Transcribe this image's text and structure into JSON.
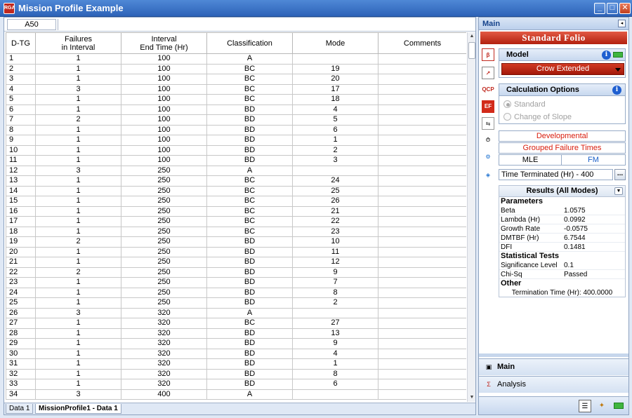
{
  "window": {
    "title": "Mission Profile Example",
    "icon_text": "RGA",
    "controls": [
      "minimize-icon",
      "maximize-icon",
      "close-icon"
    ]
  },
  "sheet": {
    "cell_ref": "A50",
    "columns": [
      {
        "line1": "D-TG",
        "line2": ""
      },
      {
        "line1": "Failures",
        "line2": "in Interval"
      },
      {
        "line1": "Interval",
        "line2": "End Time (Hr)"
      },
      {
        "line1": "Classification",
        "line2": ""
      },
      {
        "line1": "Mode",
        "line2": ""
      },
      {
        "line1": "Comments",
        "line2": ""
      }
    ],
    "rows": [
      [
        "1",
        "1",
        "100",
        "A",
        "",
        ""
      ],
      [
        "2",
        "1",
        "100",
        "BC",
        "19",
        ""
      ],
      [
        "3",
        "1",
        "100",
        "BC",
        "20",
        ""
      ],
      [
        "4",
        "3",
        "100",
        "BC",
        "17",
        ""
      ],
      [
        "5",
        "1",
        "100",
        "BC",
        "18",
        ""
      ],
      [
        "6",
        "1",
        "100",
        "BD",
        "4",
        ""
      ],
      [
        "7",
        "2",
        "100",
        "BD",
        "5",
        ""
      ],
      [
        "8",
        "1",
        "100",
        "BD",
        "6",
        ""
      ],
      [
        "9",
        "1",
        "100",
        "BD",
        "1",
        ""
      ],
      [
        "10",
        "1",
        "100",
        "BD",
        "2",
        ""
      ],
      [
        "11",
        "1",
        "100",
        "BD",
        "3",
        ""
      ],
      [
        "12",
        "3",
        "250",
        "A",
        "",
        ""
      ],
      [
        "13",
        "1",
        "250",
        "BC",
        "24",
        ""
      ],
      [
        "14",
        "1",
        "250",
        "BC",
        "25",
        ""
      ],
      [
        "15",
        "1",
        "250",
        "BC",
        "26",
        ""
      ],
      [
        "16",
        "1",
        "250",
        "BC",
        "21",
        ""
      ],
      [
        "17",
        "1",
        "250",
        "BC",
        "22",
        ""
      ],
      [
        "18",
        "1",
        "250",
        "BC",
        "23",
        ""
      ],
      [
        "19",
        "2",
        "250",
        "BD",
        "10",
        ""
      ],
      [
        "20",
        "1",
        "250",
        "BD",
        "11",
        ""
      ],
      [
        "21",
        "1",
        "250",
        "BD",
        "12",
        ""
      ],
      [
        "22",
        "2",
        "250",
        "BD",
        "9",
        ""
      ],
      [
        "23",
        "1",
        "250",
        "BD",
        "7",
        ""
      ],
      [
        "24",
        "1",
        "250",
        "BD",
        "8",
        ""
      ],
      [
        "25",
        "1",
        "250",
        "BD",
        "2",
        ""
      ],
      [
        "26",
        "3",
        "320",
        "A",
        "",
        ""
      ],
      [
        "27",
        "1",
        "320",
        "BC",
        "27",
        ""
      ],
      [
        "28",
        "1",
        "320",
        "BD",
        "13",
        ""
      ],
      [
        "29",
        "1",
        "320",
        "BD",
        "9",
        ""
      ],
      [
        "30",
        "1",
        "320",
        "BD",
        "4",
        ""
      ],
      [
        "31",
        "1",
        "320",
        "BD",
        "1",
        ""
      ],
      [
        "32",
        "1",
        "320",
        "BD",
        "8",
        ""
      ],
      [
        "33",
        "1",
        "320",
        "BD",
        "6",
        ""
      ],
      [
        "34",
        "3",
        "400",
        "A",
        "",
        ""
      ]
    ],
    "tabs": [
      "Data 1",
      "MissionProfile1 - Data 1"
    ]
  },
  "panel": {
    "header": "Main",
    "folio_title": "Standard Folio",
    "model": {
      "title": "Model",
      "selected": "Crow Extended"
    },
    "calc_options": {
      "title": "Calculation Options",
      "options": [
        "Standard",
        "Change of Slope"
      ]
    },
    "developmental": "Developmental",
    "grouped": "Grouped Failure Times",
    "mle": "MLE",
    "fm": "FM",
    "time_terminated": "Time Terminated (Hr) - 400",
    "dots": "...",
    "results": {
      "title": "Results (All Modes)",
      "parameters_label": "Parameters",
      "parameters": [
        {
          "k": "Beta",
          "v": "1.0575"
        },
        {
          "k": "Lambda (Hr)",
          "v": "0.0992"
        },
        {
          "k": "Growth Rate",
          "v": "-0.0575"
        },
        {
          "k": "DMTBF (Hr)",
          "v": "6.7544"
        },
        {
          "k": "DFI",
          "v": "0.1481"
        }
      ],
      "stats_label": "Statistical Tests",
      "stats": [
        {
          "k": "Significance Level",
          "v": "0.1"
        },
        {
          "k": "Chi-Sq",
          "v": "Passed"
        }
      ],
      "other_label": "Other",
      "termination": "Termination Time (Hr): 400.0000"
    },
    "nav": [
      {
        "label": "Main",
        "icon": "main-icon"
      },
      {
        "label": "Analysis",
        "icon": "analysis-icon"
      }
    ],
    "side_icons": [
      "beta-icon",
      "plot-icon",
      "qcp-icon",
      "ef-icon",
      "transfer-icon",
      "calculate-icon",
      "plot-group-icon",
      "report-icon"
    ],
    "colors": {
      "accent_red": "#c0281e",
      "title_blue": "#2d63b8"
    }
  }
}
